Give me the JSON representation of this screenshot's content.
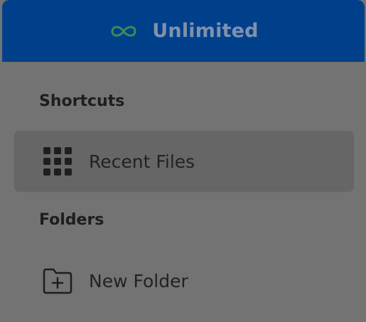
{
  "banner": {
    "label": "Unlimited",
    "icon": "infinity-icon",
    "accent_color": "#3d8a5c"
  },
  "sections": {
    "shortcuts_title": "Shortcuts",
    "folders_title": "Folders"
  },
  "shortcuts": [
    {
      "label": "Recent Files",
      "icon": "grid-icon",
      "selected": true
    }
  ],
  "folders": [
    {
      "label": "New Folder",
      "icon": "folder-plus-icon"
    }
  ]
}
